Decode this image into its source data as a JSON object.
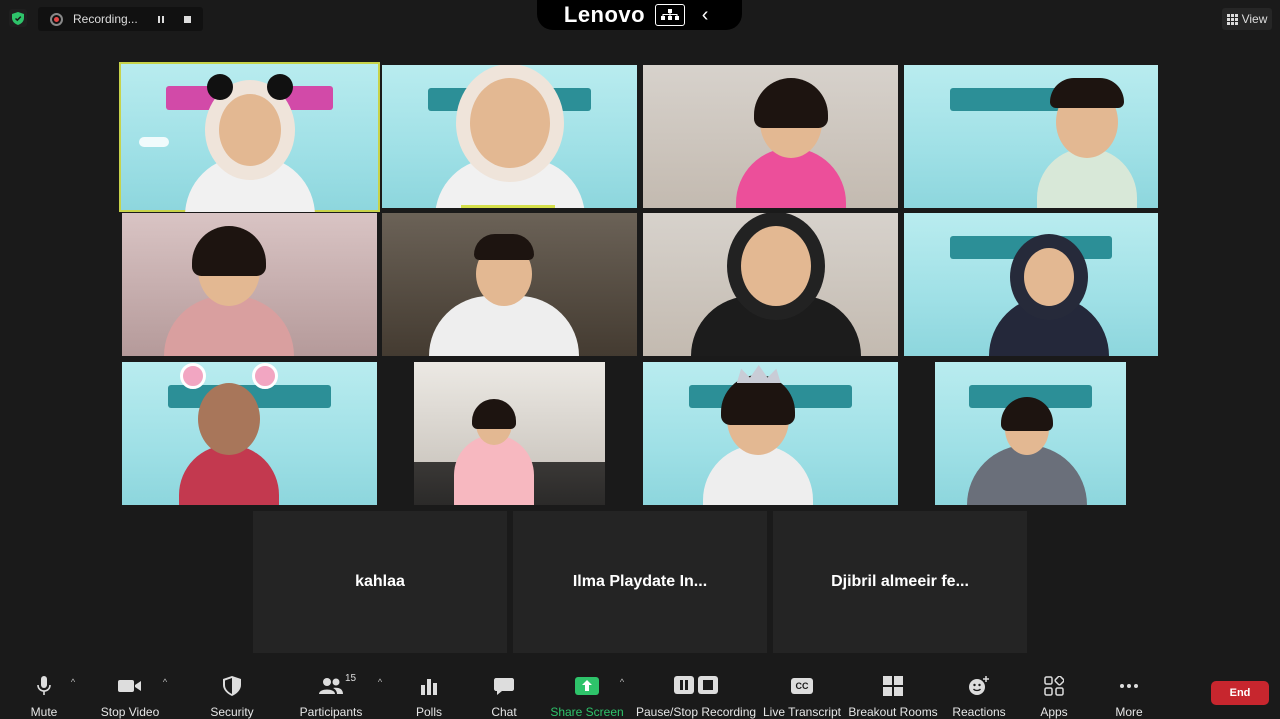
{
  "top_bar": {
    "recording_label": "Recording...",
    "brand": "Lenovo",
    "view_label": "View"
  },
  "tiles": [
    {
      "kind": "teal-speaker",
      "person": "hijab",
      "accessory": "mouse-ears"
    },
    {
      "kind": "teal",
      "person": "hijab"
    },
    {
      "kind": "room",
      "person": "pink-shirt"
    },
    {
      "kind": "teal",
      "person": "kid"
    },
    {
      "kind": "pink",
      "person": "girl"
    },
    {
      "kind": "dark",
      "person": "white-shirt"
    },
    {
      "kind": "room",
      "person": "hijab-black"
    },
    {
      "kind": "teal",
      "person": "hijab-dark"
    },
    {
      "kind": "teal",
      "person": "girl",
      "accessory": "pink-bun-ears"
    },
    {
      "kind": "wall",
      "person": "dress"
    },
    {
      "kind": "teal",
      "person": "girl",
      "accessory": "crown"
    },
    {
      "kind": "teal",
      "person": "girl"
    }
  ],
  "name_tiles": [
    "kahlaa",
    "Ilma Playdate In...",
    "Djibril almeeir fe..."
  ],
  "toolbar": {
    "mute": "Mute",
    "stop_video": "Stop Video",
    "security": "Security",
    "participants": "Participants",
    "participants_count": "15",
    "polls": "Polls",
    "chat": "Chat",
    "share_screen": "Share Screen",
    "pause_stop_recording": "Pause/Stop Recording",
    "live_transcript": "Live Transcript",
    "live_transcript_icon_text": "CC",
    "breakout_rooms": "Breakout Rooms",
    "reactions": "Reactions",
    "apps": "Apps",
    "more": "More",
    "end": "End"
  },
  "colors": {
    "background": "#1a1a1a",
    "share_green": "#2ec36a",
    "end_red": "#c7262e",
    "active_speaker": "#c8d34a"
  }
}
